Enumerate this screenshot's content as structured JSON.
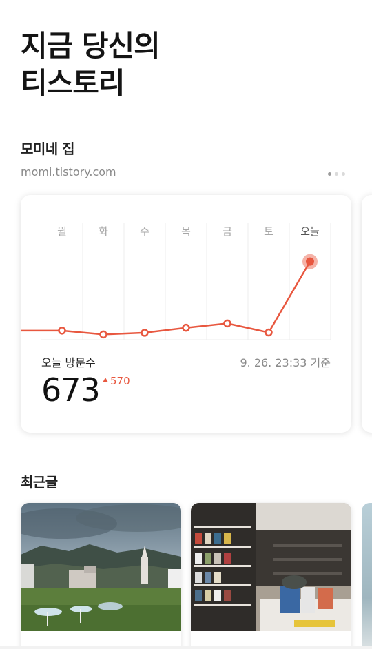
{
  "headline": {
    "line1": "지금 당신의",
    "line2": "티스토리"
  },
  "blog": {
    "name": "모미네 집",
    "url": "momi.tistory.com"
  },
  "pager": {
    "count": 3,
    "active_index": 0
  },
  "stats": {
    "today_label": "오늘 방문수",
    "timestamp": "9. 26. 23:33 기준",
    "today_count": "673",
    "delta": "570",
    "accent_color": "#e8573f"
  },
  "chart_data": {
    "type": "line",
    "categories": [
      "월",
      "화",
      "수",
      "목",
      "금",
      "토",
      "오늘"
    ],
    "values": [
      78,
      45,
      60,
      103,
      140,
      62,
      673
    ],
    "ylim": [
      0,
      760
    ],
    "grid": "vertical",
    "xlabel": "",
    "ylabel": "",
    "highlight": "오늘"
  },
  "recent": {
    "title": "최근글",
    "posts": [
      {
        "thumbnail": "landscape-mountains-photo"
      },
      {
        "thumbnail": "bookstore-interior-photo"
      }
    ]
  }
}
